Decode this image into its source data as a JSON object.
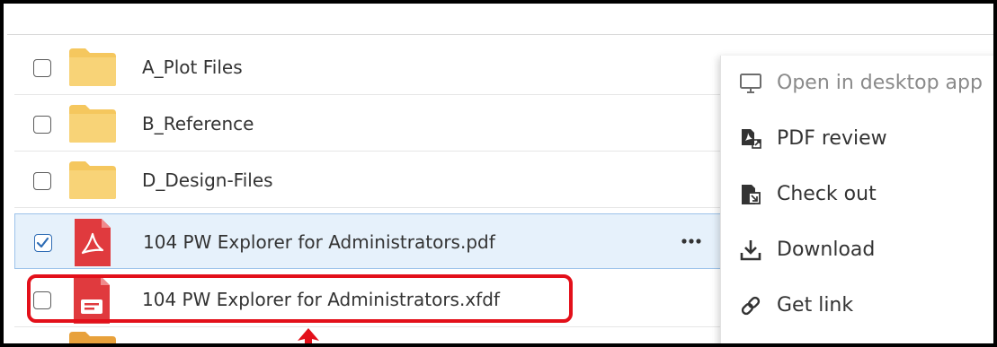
{
  "files": [
    {
      "name": "A_Plot Files",
      "type": "folder",
      "checked": false
    },
    {
      "name": "B_Reference",
      "type": "folder",
      "checked": false
    },
    {
      "name": "D_Design-Files",
      "type": "folder",
      "checked": false
    },
    {
      "name": "104 PW Explorer for Administrators.pdf",
      "type": "pdf",
      "checked": true
    },
    {
      "name": "104 PW Explorer for Administrators.xfdf",
      "type": "xfdf",
      "checked": false
    }
  ],
  "row_actions": {
    "more_label": "•••"
  },
  "context_menu": {
    "items": [
      {
        "label": "Open in desktop app",
        "icon": "monitor-icon",
        "enabled": false
      },
      {
        "label": "PDF review",
        "icon": "pdf-review-icon",
        "enabled": true
      },
      {
        "label": "Check out",
        "icon": "check-out-icon",
        "enabled": true
      },
      {
        "label": "Download",
        "icon": "download-icon",
        "enabled": true
      },
      {
        "label": "Get link",
        "icon": "link-icon",
        "enabled": true
      }
    ]
  },
  "colors": {
    "folder": "#f5c75e",
    "pdf_red": "#e03a3e",
    "selected_bg": "#e6f1fb",
    "check_blue": "#2f6db5",
    "callout_red": "#e3101a"
  }
}
